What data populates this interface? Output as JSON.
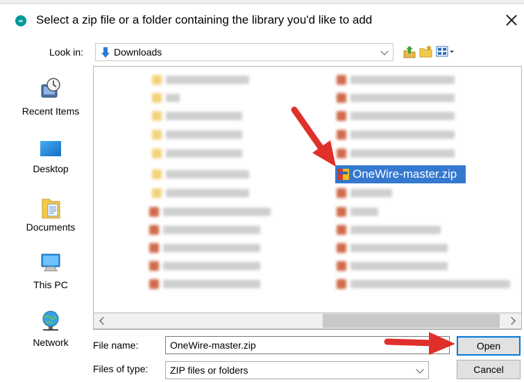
{
  "window": {
    "title": "Select a zip file or a folder containing the library you'd like to add",
    "app_icon_glyph": "∞"
  },
  "lookin": {
    "label": "Look in:",
    "value": "Downloads"
  },
  "places": [
    {
      "label": "Recent Items",
      "icon": "recent-items-icon"
    },
    {
      "label": "Desktop",
      "icon": "desktop-icon"
    },
    {
      "label": "Documents",
      "icon": "documents-icon"
    },
    {
      "label": "This PC",
      "icon": "this-pc-icon"
    },
    {
      "label": "Network",
      "icon": "network-icon"
    }
  ],
  "files": {
    "selected": "OneWire-master.zip"
  },
  "filename": {
    "label": "File name:",
    "value": "OneWire-master.zip"
  },
  "filetype": {
    "label": "Files of type:",
    "value": "ZIP files or folders"
  },
  "buttons": {
    "open": "Open",
    "cancel": "Cancel"
  },
  "colors": {
    "selection": "#3478d0",
    "annotation_arrow": "#e0302a",
    "focus_border": "#0078d7"
  }
}
